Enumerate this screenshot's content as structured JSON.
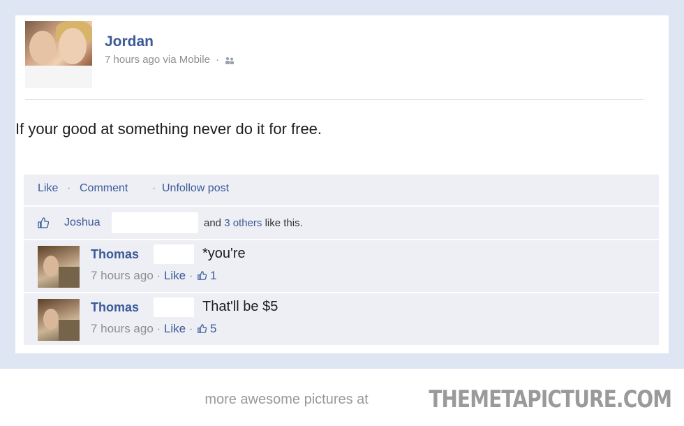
{
  "post": {
    "author": "Jordan",
    "time": "7 hours ago",
    "via": "via Mobile",
    "audience_icon": "friends-icon",
    "text": "If your good at something never do it for free."
  },
  "actions": {
    "like": "Like",
    "comment": "Comment",
    "unfollow": "Unfollow post"
  },
  "likes": {
    "name": "Joshua",
    "and": "and",
    "others_link": "3 others",
    "suffix": "like this."
  },
  "comments": [
    {
      "author": "Thomas",
      "text": "*you're",
      "time": "7 hours ago",
      "like_label": "Like",
      "like_count": "1"
    },
    {
      "author": "Thomas",
      "text": "That'll be $5",
      "time": "7 hours ago",
      "like_label": "Like",
      "like_count": "5"
    }
  ],
  "footer": {
    "text": "more awesome pictures at",
    "brand": "THEMETAPICTURE.COM"
  },
  "colors": {
    "link": "#3b5998",
    "panel": "#edeff4",
    "frame": "#dde6f2"
  }
}
